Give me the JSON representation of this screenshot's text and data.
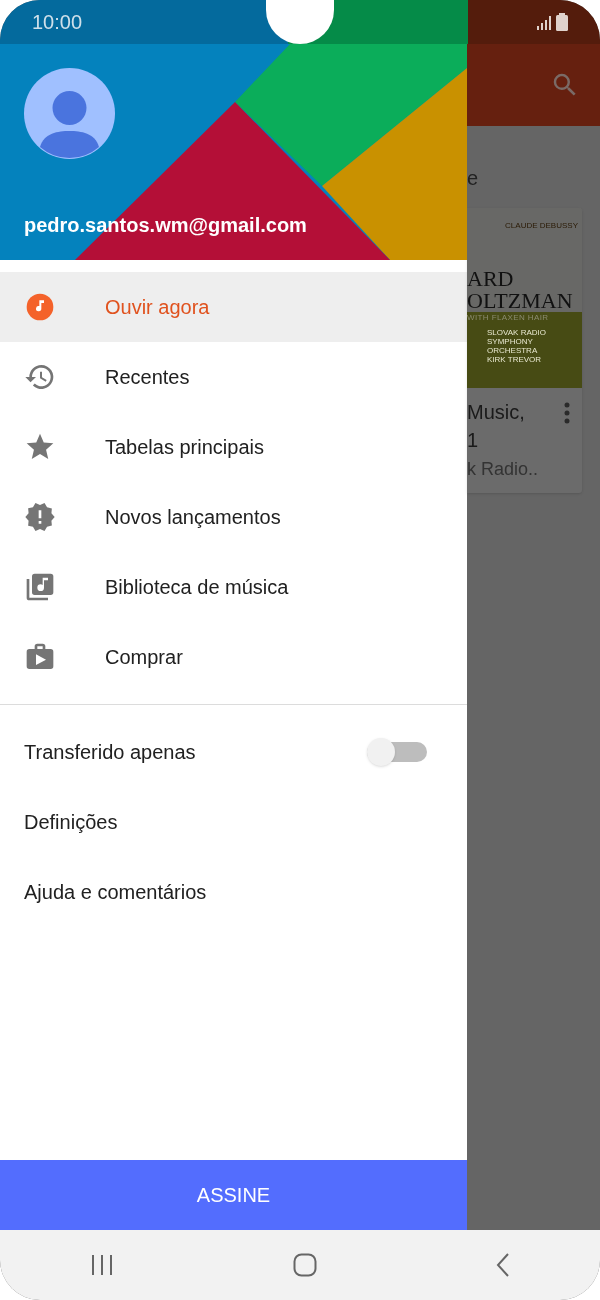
{
  "status_bar": {
    "time": "10:00"
  },
  "background_app": {
    "heading": "e",
    "card": {
      "cover": {
        "composer": "CLAUDE DEBUSSY",
        "title_line_1": "ARD",
        "title_line_2": "OLTZMAN",
        "subtitle": "WITH FLAXEN HAIR",
        "credits_1": "SLOVAK RADIO SYMPHONY ORCHESTRA",
        "credits_2": "KIRK TREVOR"
      },
      "title_line_1": "Music,",
      "title_line_2": "1",
      "subtitle": "k Radio.."
    }
  },
  "drawer": {
    "account": {
      "email": "pedro.santos.wm@gmail.com"
    },
    "nav_items": [
      {
        "label": "Ouvir agora",
        "selected": true
      },
      {
        "label": "Recentes",
        "selected": false
      },
      {
        "label": "Tabelas principais",
        "selected": false
      },
      {
        "label": "Novos lançamentos",
        "selected": false
      },
      {
        "label": "Biblioteca de música",
        "selected": false
      },
      {
        "label": "Comprar",
        "selected": false
      }
    ],
    "settings_items": [
      {
        "kind": "toggle",
        "label": "Transferido apenas",
        "on": false
      },
      {
        "kind": "link",
        "label": "Definições"
      },
      {
        "kind": "link",
        "label": "Ajuda e comentários"
      }
    ],
    "subscribe_button": "ASSINE"
  }
}
